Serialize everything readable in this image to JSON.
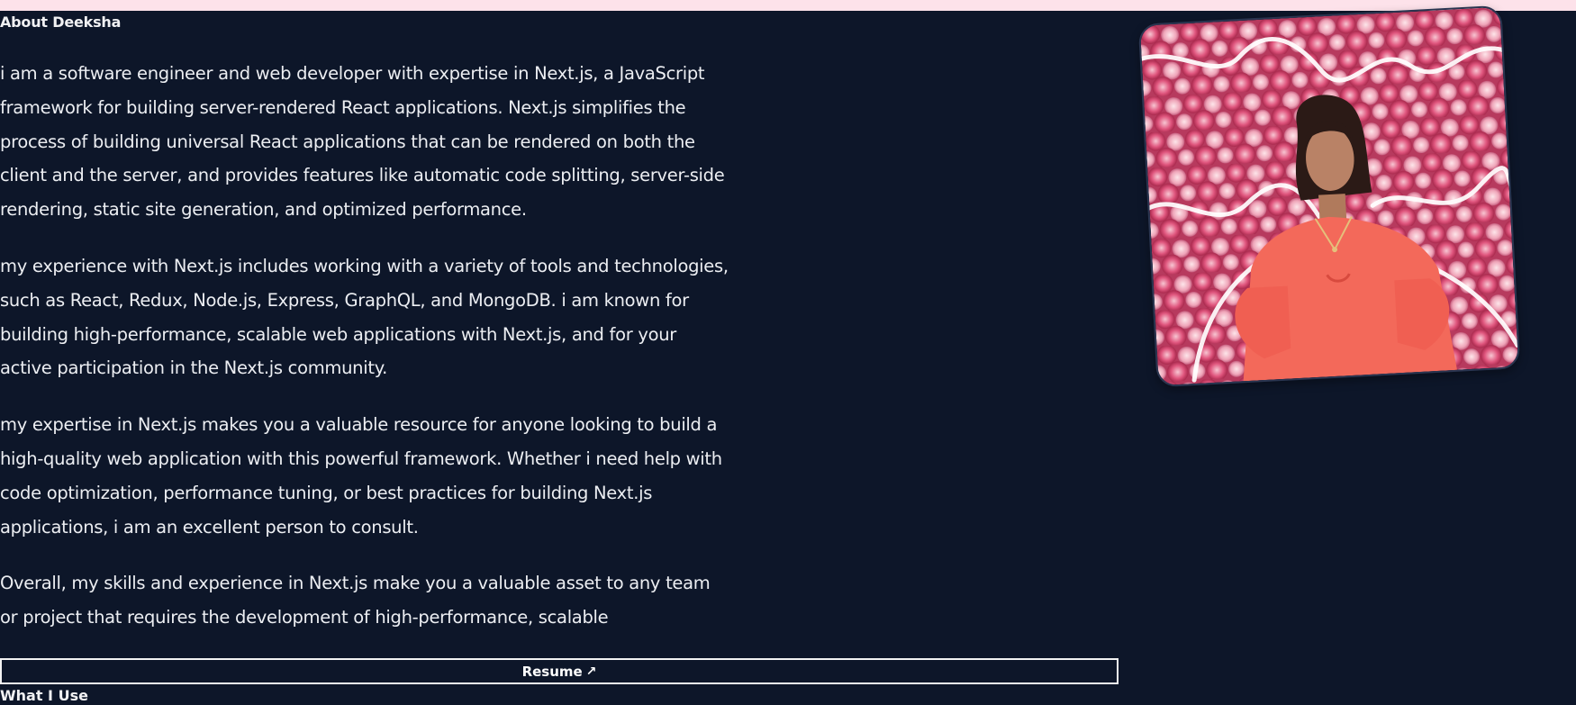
{
  "colors": {
    "background": "#0d1629",
    "top_strip": "#fde2ea",
    "text": "#eceef2",
    "button_border": "#f2f2f2"
  },
  "about": {
    "heading": "About Deeksha",
    "paragraphs": [
      "i am a software engineer and web developer with expertise in Next.js, a JavaScript framework for building server-rendered React applications. Next.js simplifies the process of building universal React applications that can be rendered on both the client and the server, and provides features like automatic code splitting, server-side rendering, static site generation, and optimized performance.",
      "my experience with Next.js includes working with a variety of tools and technologies, such as React, Redux, Node.js, Express, GraphQL, and MongoDB. i am known for building high-performance, scalable web applications with Next.js, and for your active participation in the Next.js community.",
      "my expertise in Next.js makes you a valuable resource for anyone looking to build a high-quality web application with this powerful framework. Whether i need help with code optimization, performance tuning, or best practices for building Next.js applications, i am an excellent person to consult.",
      "Overall, my skills and experience in Next.js make you a valuable asset to any team or project that requires the development of high-performance, scalable"
    ]
  },
  "resume_button": {
    "label": "Resume",
    "icon": "arrow-up-right-icon",
    "arrow": "↗"
  },
  "what_i_use": {
    "heading": "What I Use"
  },
  "profile_photo": {
    "icon": "profile-photo"
  }
}
